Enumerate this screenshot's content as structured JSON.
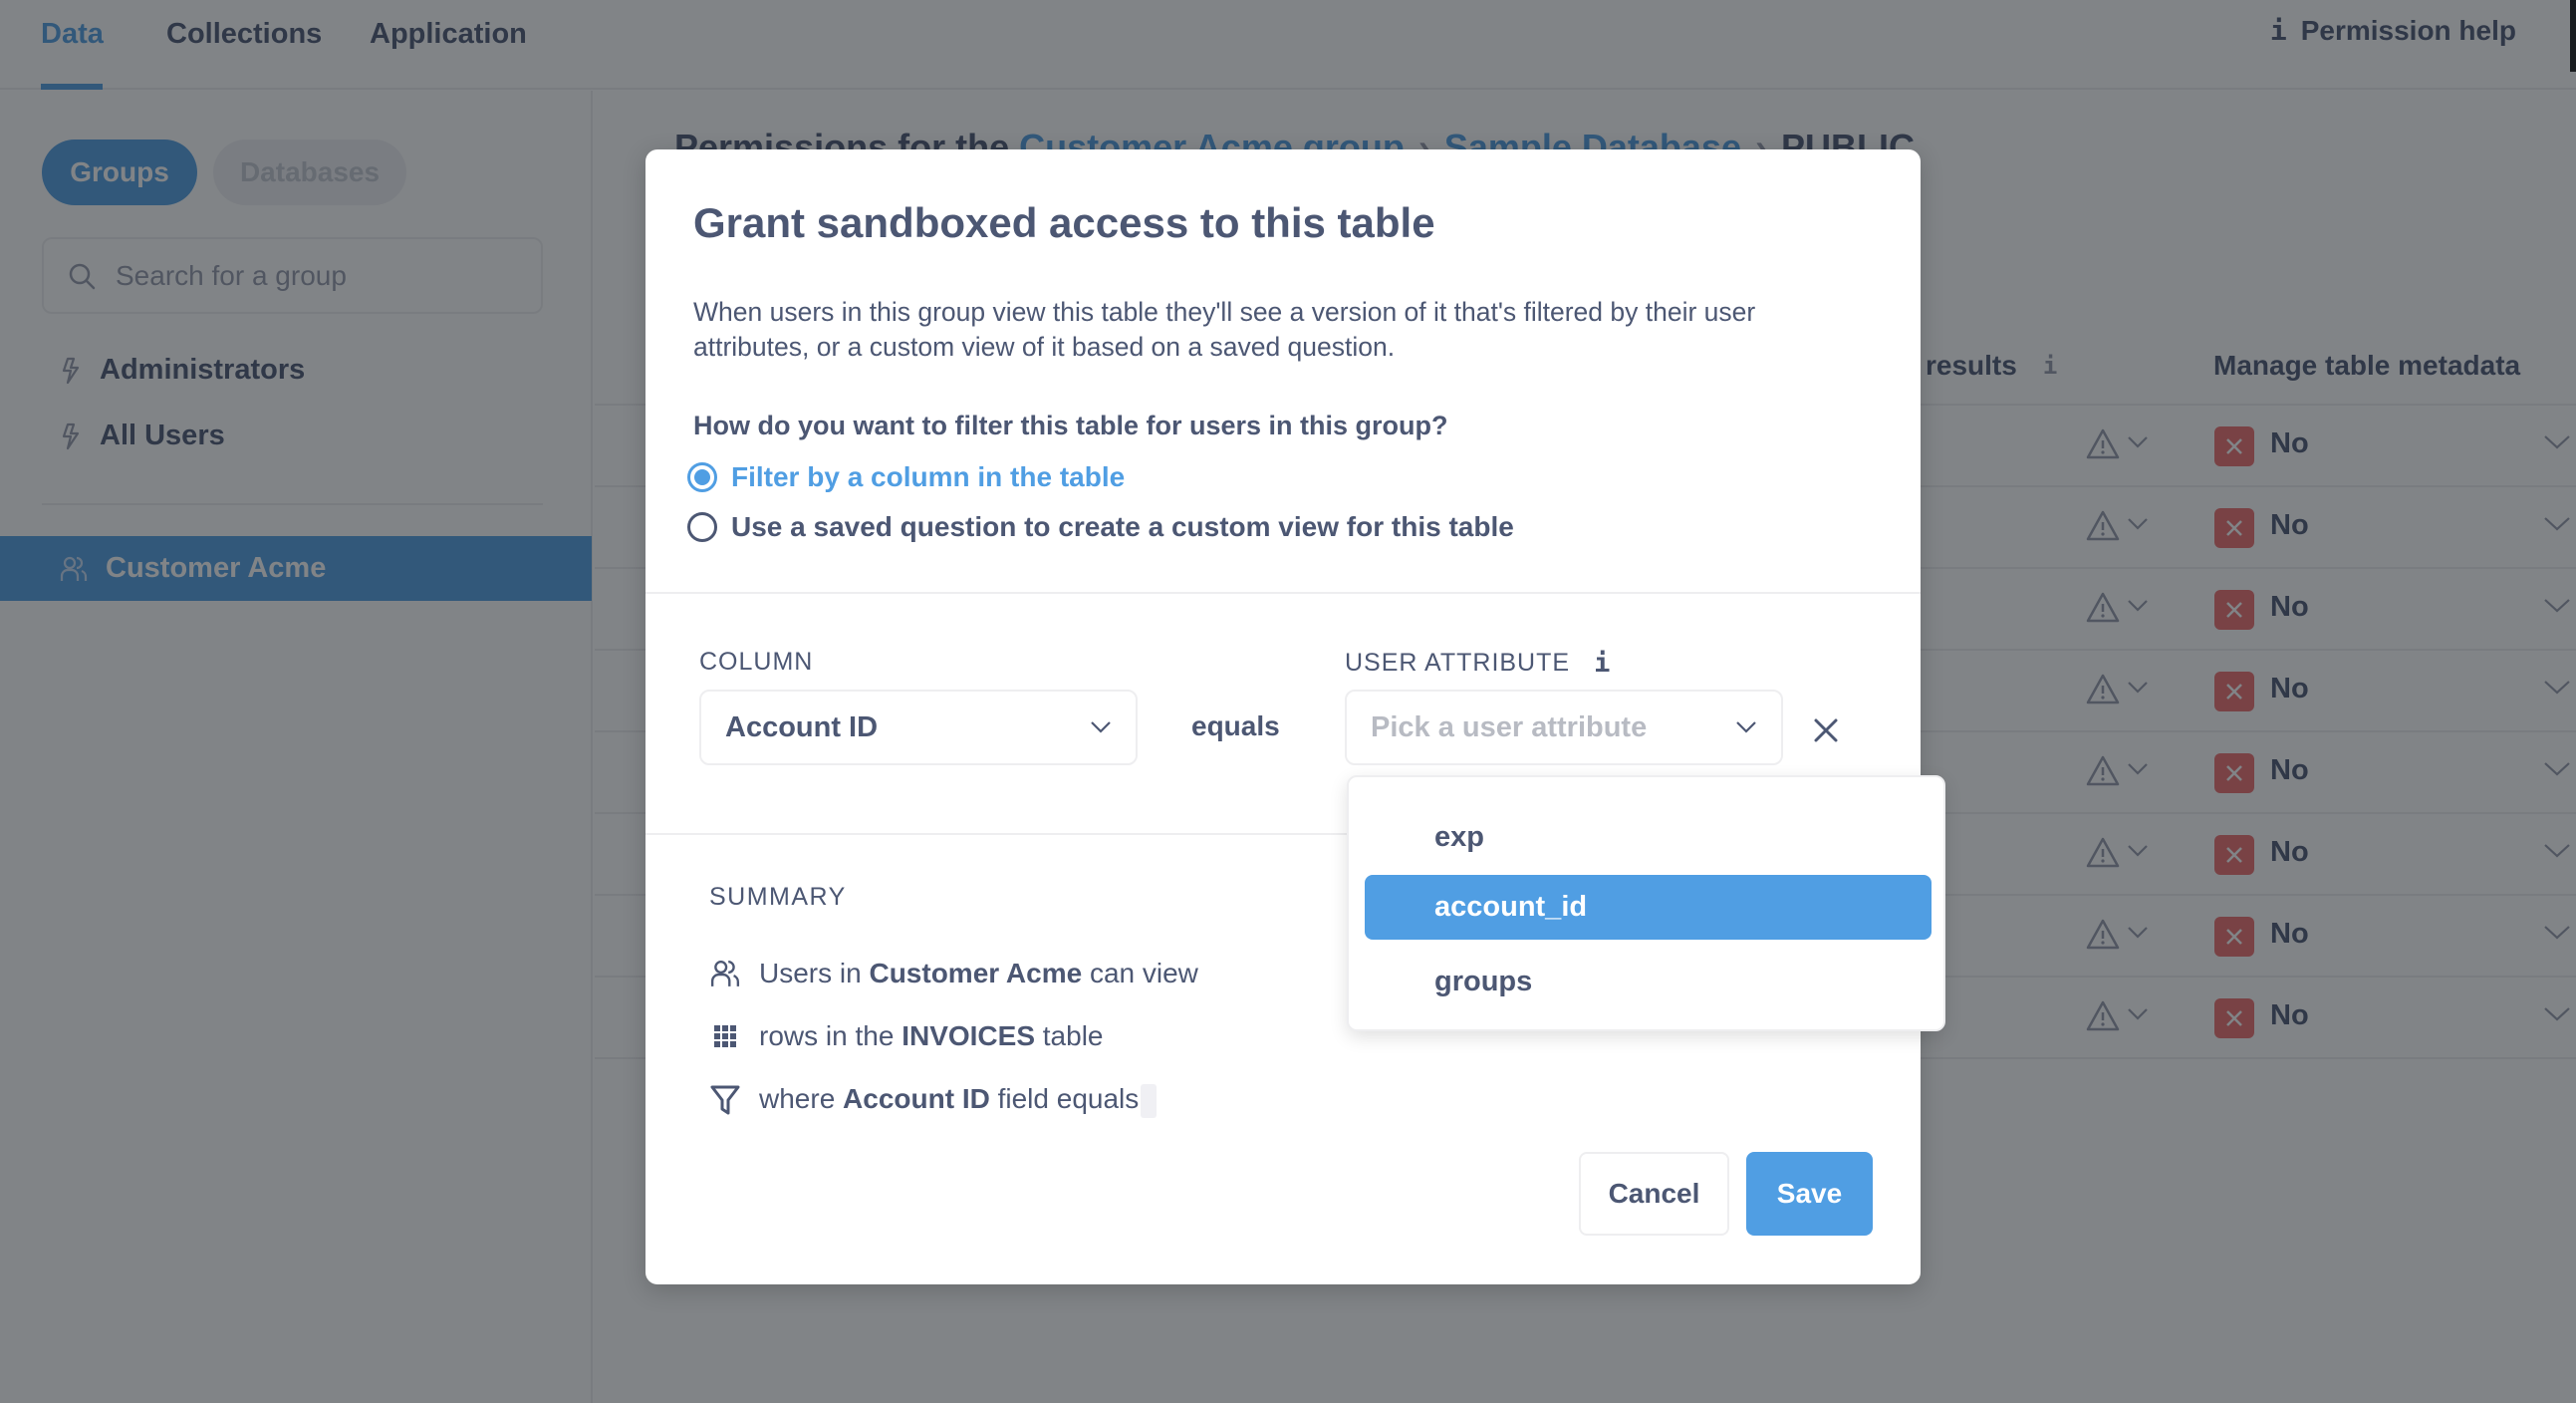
{
  "topbar": {
    "tabs": [
      {
        "label": "Data",
        "active": true
      },
      {
        "label": "Collections",
        "active": false
      },
      {
        "label": "Application",
        "active": false
      }
    ],
    "permission_help": "Permission help"
  },
  "sidebar": {
    "toggle": {
      "groups": "Groups",
      "databases": "Databases",
      "active": "Groups"
    },
    "search_placeholder": "Search for a group",
    "groups": [
      {
        "label": "Administrators",
        "icon": "bolt-icon"
      },
      {
        "label": "All Users",
        "icon": "bolt-icon"
      }
    ],
    "selected_group": {
      "label": "Customer Acme",
      "icon": "people-icon"
    }
  },
  "main": {
    "breadcrumb": {
      "prefix": "Permissions for the",
      "group_link": "Customer Acme group",
      "database": "Sample Database",
      "schema": "PUBLIC"
    },
    "columns": {
      "partial_results": "results",
      "manage_metadata": "Manage table metadata"
    },
    "rows": [
      {
        "metadata": "No"
      },
      {
        "metadata": "No"
      },
      {
        "metadata": "No"
      },
      {
        "metadata": "No"
      },
      {
        "metadata": "No"
      },
      {
        "metadata": "No"
      },
      {
        "metadata": "No"
      },
      {
        "metadata": "No"
      }
    ]
  },
  "modal": {
    "title": "Grant sandboxed access to this table",
    "description": "When users in this group view this table they'll see a version of it that's filtered by their user attributes, or a custom view of it based on a saved question.",
    "question": "How do you want to filter this table for users in this group?",
    "options": [
      {
        "label": "Filter by a column in the table",
        "checked": true
      },
      {
        "label": "Use a saved question to create a custom view for this table",
        "checked": false
      }
    ],
    "column_label": "COLUMN",
    "column_value": "Account ID",
    "operator": "equals",
    "user_attribute_label": "USER ATTRIBUTE",
    "user_attribute_placeholder": "Pick a user attribute",
    "summary": {
      "label": "SUMMARY",
      "line1": {
        "pre": "Users in",
        "bold": "Customer Acme",
        "post": "can view"
      },
      "line2": {
        "pre": "rows in the",
        "bold": "INVOICES",
        "post": "table"
      },
      "line3": {
        "pre": "where",
        "bold": "Account ID",
        "post": "field equals"
      }
    },
    "cancel_label": "Cancel",
    "save_label": "Save"
  },
  "attribute_dropdown": {
    "options": [
      "exp",
      "account_id",
      "groups"
    ],
    "highlighted": "account_id"
  },
  "colors": {
    "brand": "#509ee3",
    "text": "#4c5773",
    "danger": "#ed6e6e",
    "border": "#eeeef0"
  }
}
